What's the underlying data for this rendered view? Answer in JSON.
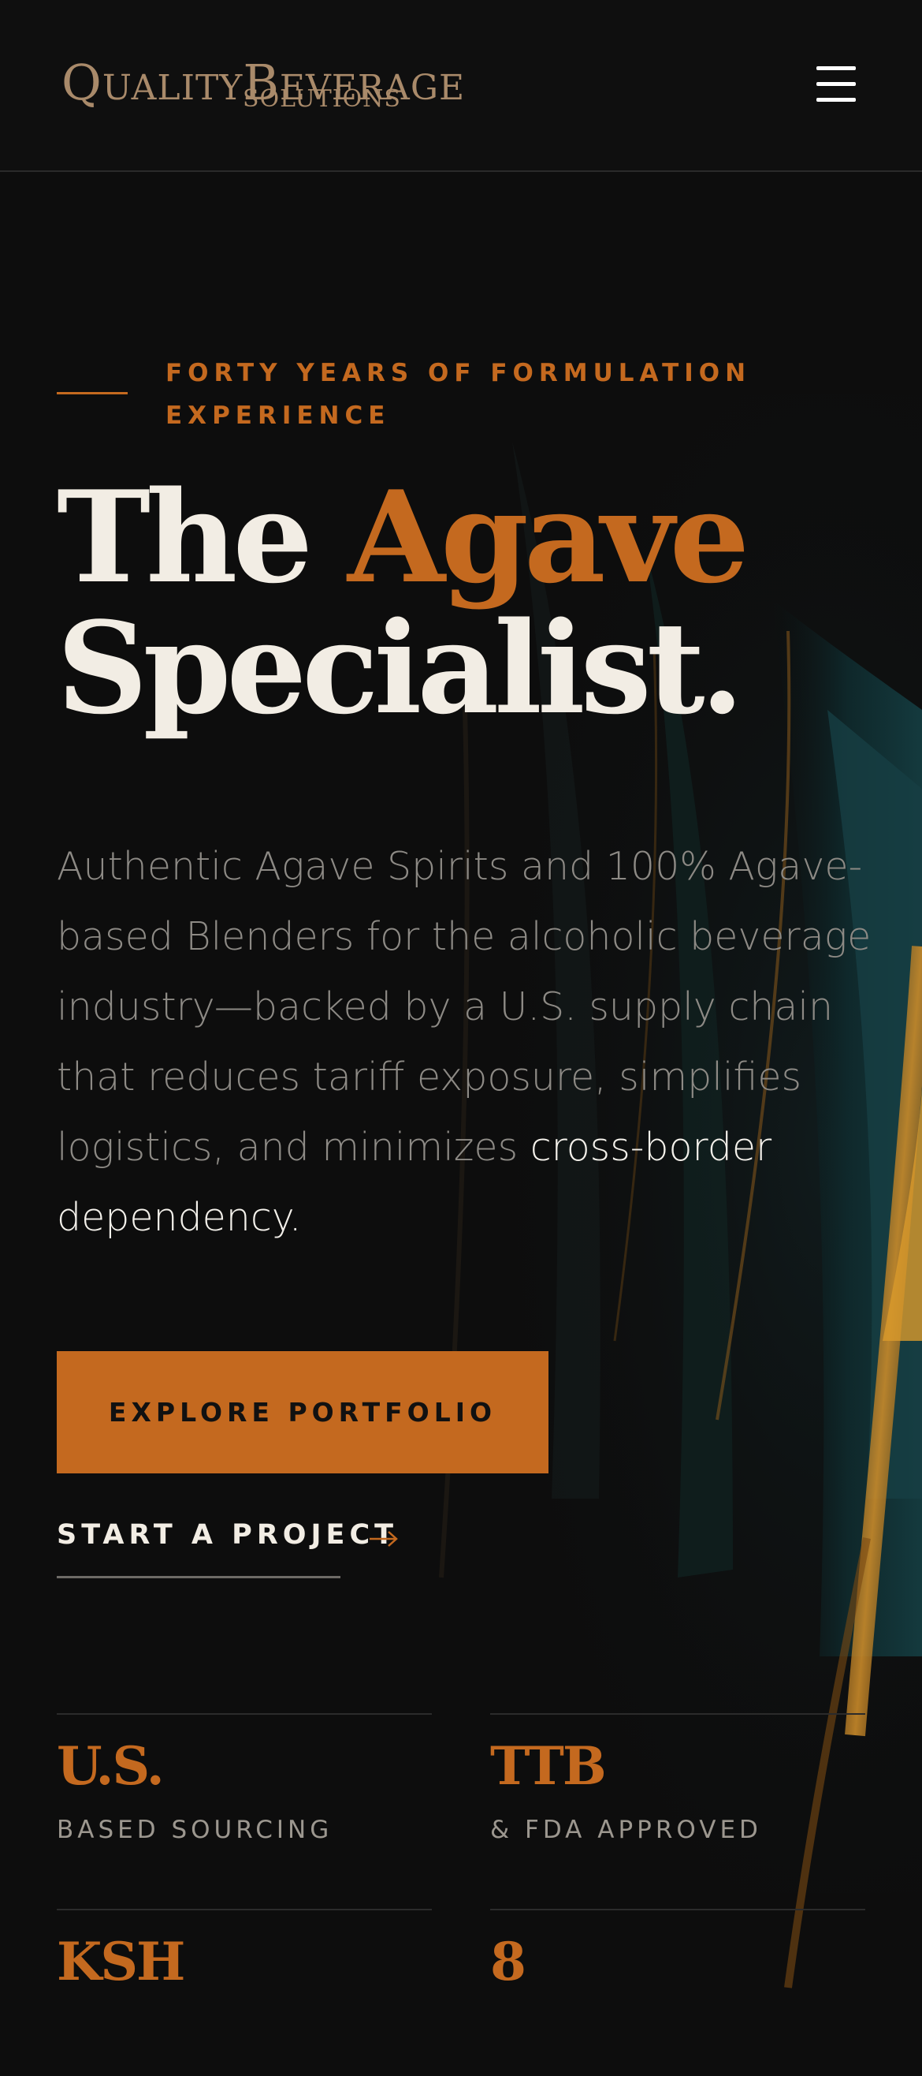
{
  "colors": {
    "background": "#0d0d0d",
    "accent": "#c4691f",
    "logo": "#a98a6a",
    "text_primary": "#f2ede4",
    "text_muted": "#8d8a85"
  },
  "header": {
    "logo": {
      "line1_q": "Q",
      "line1_rest_a": "UALITY",
      "line1_b": "B",
      "line1_rest_b": "EVERAGE",
      "line2": "SOLUTIONS"
    },
    "menu_icon": "hamburger-menu-icon"
  },
  "hero": {
    "eyebrow": "FORTY YEARS OF FORMULATION EXPERIENCE",
    "headline_part1": "The ",
    "headline_accent": "Agave",
    "headline_part2": "Specialist.",
    "body_muted": "Authentic Agave Spirits and 100% Agave-based Blenders for the alcoholic beverage industry—backed by a U.S. supply chain that reduces tariff exposure, simplifies logistics, and minimizes ",
    "body_highlight": "cross-border dependency.",
    "primary_cta": "EXPLORE PORTFOLIO",
    "secondary_cta": "START A PROJECT",
    "secondary_cta_icon": "arrow-right-icon"
  },
  "stats": [
    {
      "value": "U.S.",
      "label": "BASED SOURCING"
    },
    {
      "value": "TTB",
      "label": "& FDA APPROVED"
    },
    {
      "value": "KSH",
      "label": ""
    },
    {
      "value": "8",
      "label": ""
    }
  ]
}
